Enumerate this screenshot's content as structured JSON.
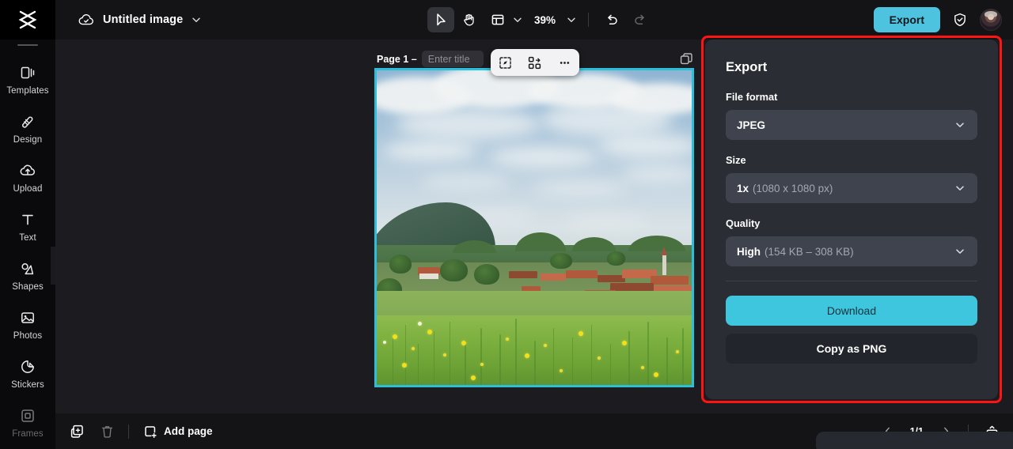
{
  "app": {
    "logo": "capcut-logo-icon",
    "document_title": "Untitled image",
    "cloud_status_icon": "cloud-check-icon",
    "title_chevron_icon": "chevron-down-icon"
  },
  "toolbar": {
    "select_tool": "cursor-tool",
    "hand_tool": "hand-tool",
    "layout_tool": "layout-tool",
    "layout_chevron": "chevron-down-icon",
    "zoom_level": "39%",
    "zoom_chevron": "chevron-down-icon",
    "undo": "undo-icon",
    "redo": "redo-icon",
    "export_label": "Export",
    "shield_icon": "shield-check-icon",
    "avatar": "user-avatar"
  },
  "sidebar": {
    "items": [
      {
        "label": "Templates",
        "icon": "templates-icon",
        "dim": false
      },
      {
        "label": "Design",
        "icon": "design-icon",
        "dim": false
      },
      {
        "label": "Upload",
        "icon": "upload-cloud-icon",
        "dim": false
      },
      {
        "label": "Text",
        "icon": "text-icon",
        "dim": false
      },
      {
        "label": "Shapes",
        "icon": "shapes-icon",
        "dim": false
      },
      {
        "label": "Photos",
        "icon": "photos-icon",
        "dim": false
      },
      {
        "label": "Stickers",
        "icon": "stickers-icon",
        "dim": false
      },
      {
        "label": "Frames",
        "icon": "frames-icon",
        "dim": true
      }
    ],
    "expand_toggle_icon": "chevron-right-icon"
  },
  "canvas": {
    "page_label": "Page 1 –",
    "title_placeholder": "Enter title",
    "title_value": "",
    "duplicate_page_icon": "copy-page-icon",
    "floating_tools": [
      {
        "icon": "magic-select-icon"
      },
      {
        "icon": "replace-swap-icon"
      },
      {
        "icon": "more-options-icon"
      }
    ],
    "artwork_description": "Alpine village meadow landscape with yellow wildflowers",
    "selection_color": "#2bbfd9"
  },
  "export": {
    "title": "Export",
    "file_format_label": "File format",
    "file_format_value": "JPEG",
    "size_label": "Size",
    "size_value": "1x",
    "size_detail": "(1080 x 1080 px)",
    "quality_label": "Quality",
    "quality_value": "High",
    "quality_detail": "(154 KB – 308 KB)",
    "download_label": "Download",
    "copy_png_label": "Copy as PNG",
    "chevron_icon": "chevron-down-icon",
    "accent_color": "#3ec6de",
    "highlight_color": "#ff1313"
  },
  "bottom": {
    "duplicate_icon": "duplicate-page-icon",
    "delete_icon": "trash-icon",
    "add_page_label": "Add page",
    "add_page_icon": "add-page-icon",
    "prev_icon": "chevron-left-icon",
    "next_icon": "chevron-right-icon",
    "page_indicator": "1/1",
    "collapse_icon": "collapse-panel-icon"
  }
}
